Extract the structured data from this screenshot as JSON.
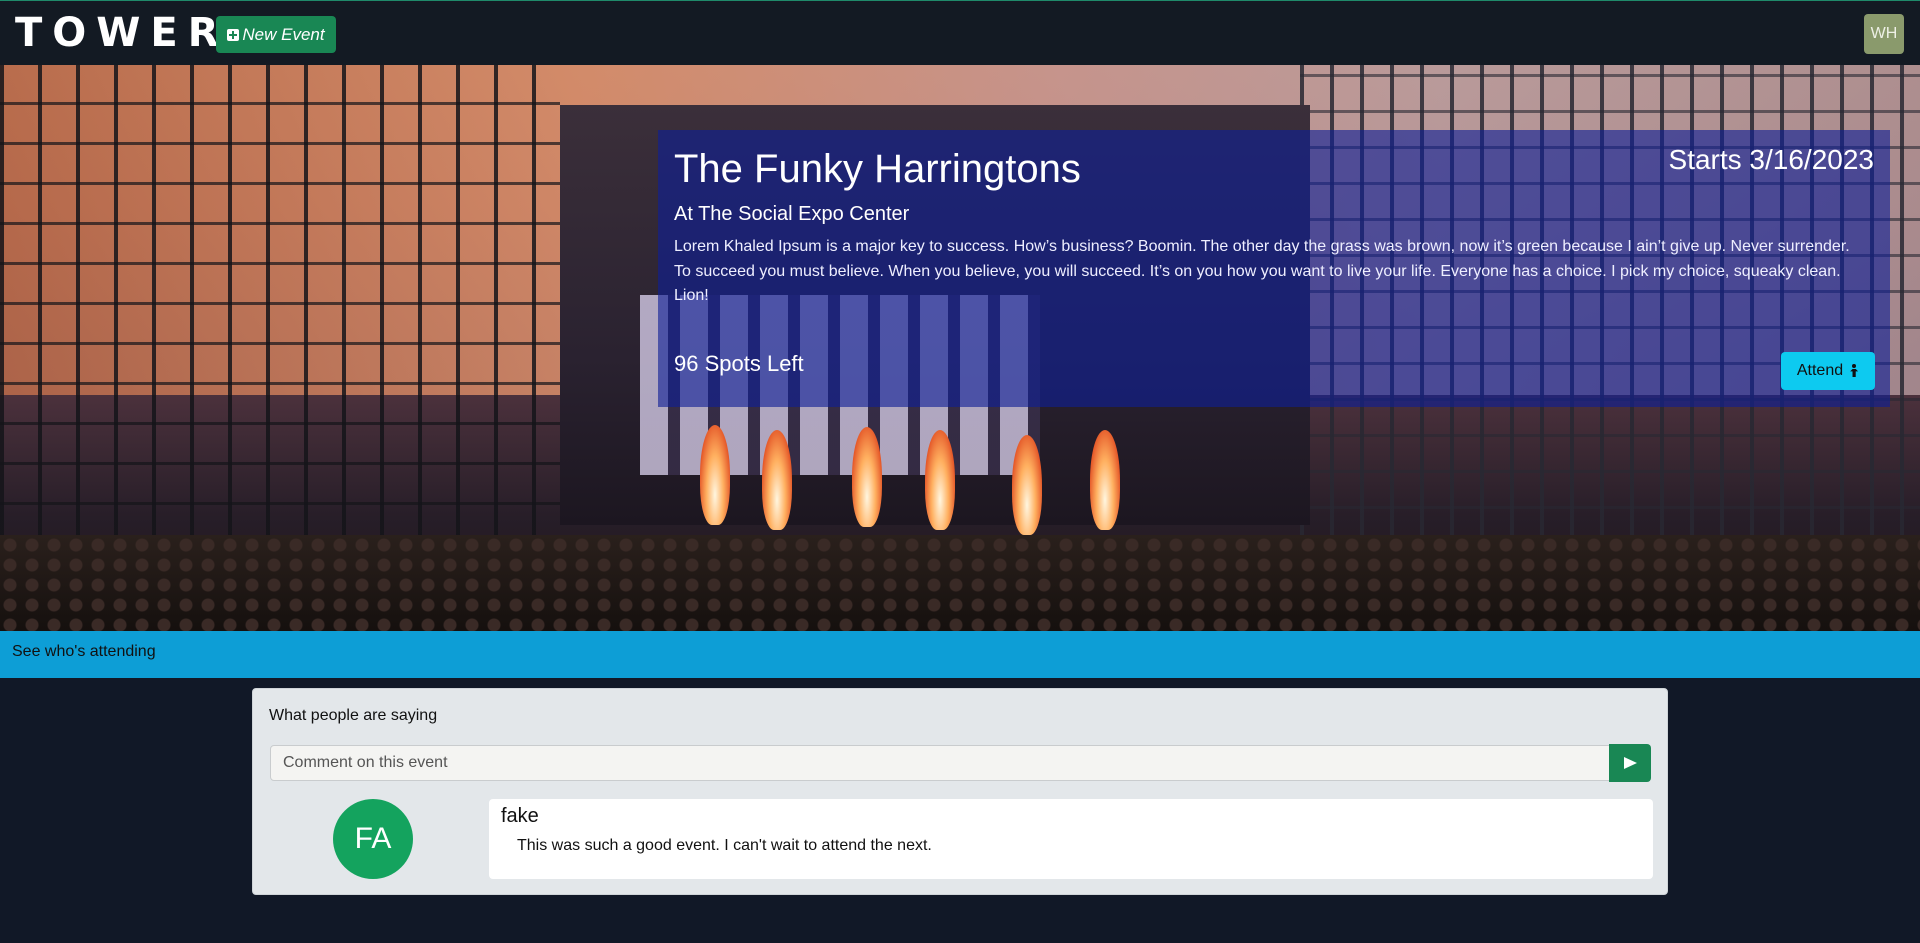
{
  "navbar": {
    "brand": "TOWER",
    "new_event_label": "New Event",
    "user_initials": "WH"
  },
  "event": {
    "title": "The Funky Harringtons",
    "location": "At The Social Expo Center",
    "description": "Lorem Khaled Ipsum is a major key to success. How’s business? Boomin. The other day the grass was brown, now it’s green because I ain’t give up. Never surrender. To succeed you must believe. When you believe, you will succeed. It’s on you how you want to live your life. Everyone has a choice. I pick my choice, squeaky clean. Lion!",
    "start": "Starts 3/16/2023",
    "spots_left": "96 Spots Left",
    "attend_label": "Attend"
  },
  "attending": {
    "label": "See who's attending"
  },
  "comments": {
    "heading": "What people are saying",
    "input_placeholder": "Comment on this event",
    "items": [
      {
        "initials": "FA",
        "author": "fake",
        "body": "This was such a good event. I can't wait to attend the next."
      }
    ]
  },
  "colors": {
    "background": "#111827",
    "success": "#198754",
    "info": "#0dcaf0",
    "attending_bar": "#0d9ed6",
    "event_panel": "#0f1e96"
  }
}
